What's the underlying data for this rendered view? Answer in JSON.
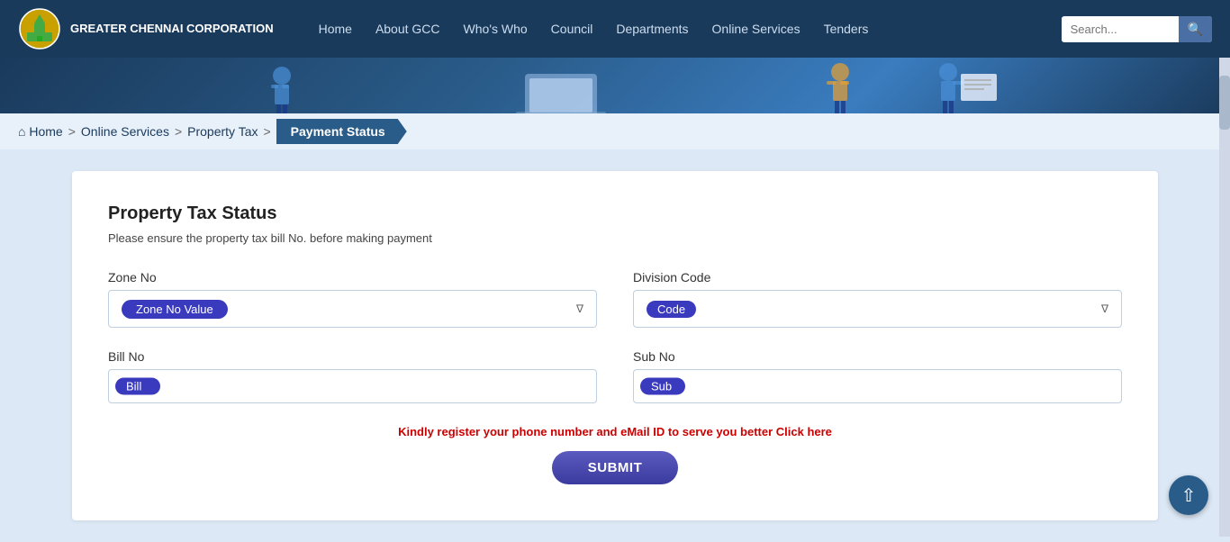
{
  "app": {
    "title": "GREATER CHENNAI CORPORATION",
    "logo_alt": "GCC Logo"
  },
  "navbar": {
    "links": [
      {
        "label": "Home",
        "id": "home"
      },
      {
        "label": "About GCC",
        "id": "about"
      },
      {
        "label": "Who's Who",
        "id": "whos-who"
      },
      {
        "label": "Council",
        "id": "council"
      },
      {
        "label": "Departments",
        "id": "departments"
      },
      {
        "label": "Online Services",
        "id": "online-services"
      },
      {
        "label": "Tenders",
        "id": "tenders"
      }
    ],
    "search_placeholder": "Search..."
  },
  "breadcrumb": {
    "items": [
      {
        "label": "Home",
        "id": "bc-home"
      },
      {
        "label": "Online Services",
        "id": "bc-online"
      },
      {
        "label": "Property Tax",
        "id": "bc-propertytax"
      }
    ],
    "active": "Payment Status"
  },
  "form": {
    "title": "Property Tax Status",
    "subtitle": "Please ensure the property tax bill No. before making payment",
    "zone_no_label": "Zone No",
    "zone_no_value": "Zone No Value",
    "division_code_label": "Division Code",
    "division_code_value": "Code",
    "bill_no_label": "Bill No",
    "bill_no_value": "Bill",
    "sub_no_label": "Sub No",
    "sub_no_value": "Sub",
    "register_notice": "Kindly register your phone number and eMail ID to serve you better Click here",
    "submit_label": "SUBMIT"
  },
  "icons": {
    "home": "⌂",
    "search": "🔍",
    "arrow_up": "↑"
  }
}
